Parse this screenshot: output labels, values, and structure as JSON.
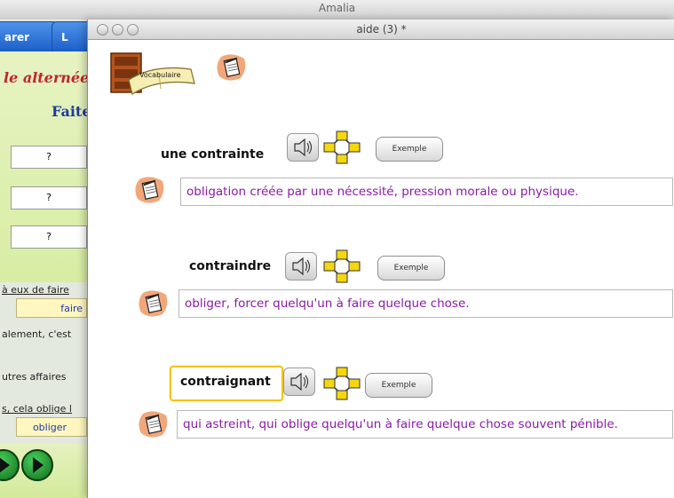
{
  "background_app": {
    "title": "Amalia",
    "tab1_label": "arer",
    "tab2_label": "L",
    "heading_red": "le alternée",
    "heading_blue": "Faite",
    "boxes": [
      "?",
      "?",
      "?"
    ],
    "text_lines": [
      "à eux de faire",
      "alement, c'est",
      "utres affaires",
      "s, cela oblige l"
    ],
    "field1": "faire",
    "field2": "obliger"
  },
  "window": {
    "title": "aide (3) *",
    "vocab_label": "Vocabulaire"
  },
  "entries": [
    {
      "term": "une  contrainte",
      "exemple_label": "Exemple",
      "definition": "obligation créée par une nécessité, pression morale ou physique."
    },
    {
      "term": "contraindre",
      "exemple_label": "Exemple",
      "definition": "obliger, forcer quelqu'un à faire quelque chose."
    },
    {
      "term": "contraignant",
      "exemple_label": "Exemple",
      "definition": "qui astreint, qui oblige quelqu'un à faire quelque chose souvent pénible."
    }
  ],
  "colors": {
    "definition_text": "#8a1aa6",
    "selection_border": "#f0c419",
    "tab_blue": "#1b5dc8",
    "heading_red": "#c0252e",
    "heading_blue": "#1f3b9c"
  }
}
